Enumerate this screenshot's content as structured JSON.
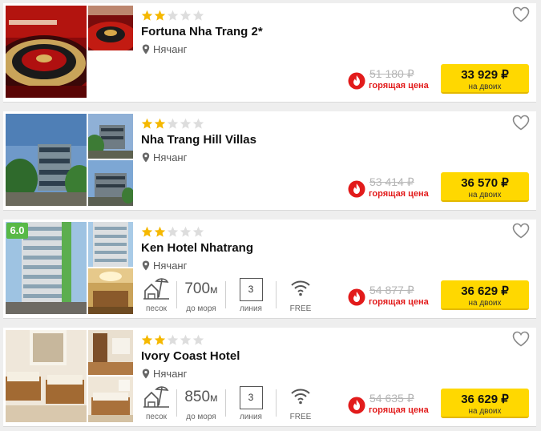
{
  "hotels": [
    {
      "name": "Fortuna Nha Trang 2*",
      "stars_filled": 2,
      "stars_total": 5,
      "location": "Нячанг",
      "old_price": "51 180 ₽",
      "hot_label": "горящая цена",
      "price": "33 929 ₽",
      "price_sub": "на двоих"
    },
    {
      "name": "Nha Trang Hill Villas",
      "stars_filled": 2,
      "stars_total": 5,
      "location": "Нячанг",
      "old_price": "53 414 ₽",
      "hot_label": "горящая цена",
      "price": "36 570 ₽",
      "price_sub": "на двоих"
    },
    {
      "name": "Ken Hotel Nhatrang",
      "rating": "6.0",
      "stars_filled": 2,
      "stars_total": 5,
      "location": "Нячанг",
      "beach_label": "песок",
      "distance_value": "700",
      "distance_unit": "м",
      "distance_label": "до моря",
      "line_value": "3",
      "line_label": "линия",
      "wifi_label": "FREE",
      "old_price": "54 877 ₽",
      "hot_label": "горящая цена",
      "price": "36 629 ₽",
      "price_sub": "на двоих"
    },
    {
      "name": "Ivory Coast Hotel",
      "stars_filled": 2,
      "stars_total": 5,
      "location": "Нячанг",
      "beach_label": "песок",
      "distance_value": "850",
      "distance_unit": "м",
      "distance_label": "до моря",
      "line_value": "3",
      "line_label": "линия",
      "wifi_label": "FREE",
      "old_price": "54 635 ₽",
      "hot_label": "горящая цена",
      "price": "36 629 ₽",
      "price_sub": "на двоих"
    }
  ],
  "icons": [
    "star-icon",
    "location-pin-icon",
    "heart-icon",
    "fire-icon",
    "beach-icon",
    "wifi-icon"
  ],
  "colors": {
    "star_filled": "#f5b800",
    "star_empty": "#dddddd",
    "price_button": "#ffd800",
    "hot_red": "#e21b1b",
    "rating_green": "#58b947"
  }
}
